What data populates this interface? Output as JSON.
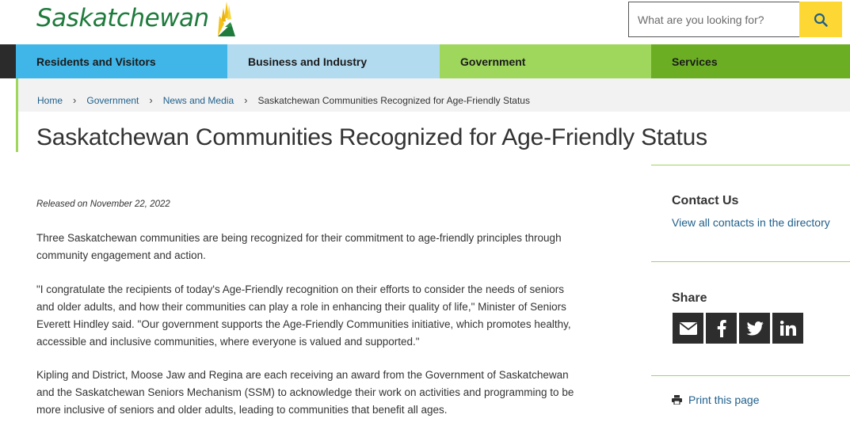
{
  "header": {
    "logo_text": "Saskatchewan",
    "search_placeholder": "What are you looking for?",
    "search_icon": "search-icon"
  },
  "nav": {
    "items": [
      {
        "label": "Residents and Visitors",
        "color": "#40b6e8"
      },
      {
        "label": "Business and Industry",
        "color": "#b3dbf0"
      },
      {
        "label": "Government",
        "color": "#9fd65c",
        "active": true
      },
      {
        "label": "Services",
        "color": "#6bae24"
      }
    ]
  },
  "breadcrumb": {
    "items": [
      "Home",
      "Government",
      "News and Media"
    ],
    "current": "Saskatchewan Communities Recognized for Age-Friendly Status",
    "separator": "›"
  },
  "page": {
    "title": "Saskatchewan Communities Recognized for Age-Friendly Status",
    "released": "Released on November 22, 2022",
    "paragraphs": [
      "Three Saskatchewan communities are being recognized for their commitment to age-friendly principles through community engagement and action.",
      "\"I congratulate the recipients of today's Age-Friendly recognition on their efforts to consider the needs of seniors and older adults, and how their communities can play a role in enhancing their quality of life,\" Minister of Seniors Everett Hindley said. \"Our government supports the Age-Friendly Communities initiative, which promotes healthy, accessible and inclusive communities, where everyone is valued and supported.\"",
      "Kipling and District, Moose Jaw and Regina are each receiving an award from the Government of Saskatchewan and the Saskatchewan Seniors Mechanism (SSM) to acknowledge their work on activities and programming to be more inclusive of seniors and older adults, leading to communities that benefit all ages."
    ]
  },
  "sidebar": {
    "contact_heading": "Contact Us",
    "contact_link": "View all contacts in the directory",
    "share_heading": "Share",
    "share_icons": [
      "email-icon",
      "facebook-icon",
      "twitter-icon",
      "linkedin-icon"
    ],
    "print_label": "Print this page",
    "print_icon": "printer-icon"
  },
  "colors": {
    "brand_green": "#1e7b3c",
    "link": "#1f5f8b",
    "accent_yellow": "#fdd835",
    "rule_green": "#9fd65c"
  }
}
